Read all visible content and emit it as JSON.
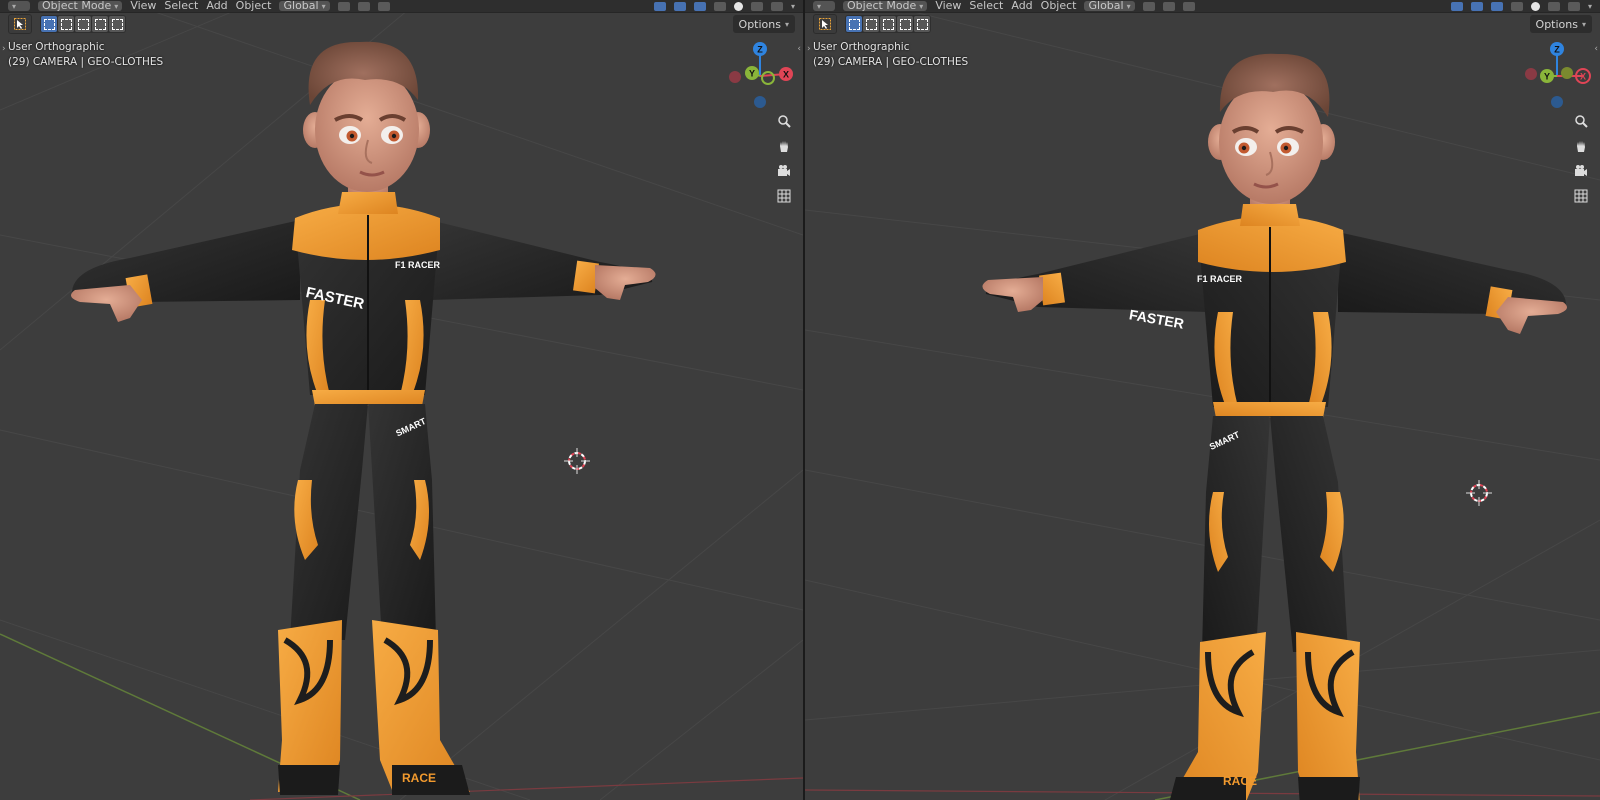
{
  "header": {
    "mode": "Object Mode",
    "menus": [
      "View",
      "Select",
      "Add",
      "Object"
    ],
    "orientation": "Global"
  },
  "toolbar": {
    "options_label": "Options"
  },
  "viewports": [
    {
      "view_name": "User Orthographic",
      "collection_info": "(29) CAMERA | GEO-CLOTHES"
    },
    {
      "view_name": "User Orthographic",
      "collection_info": "(29) CAMERA | GEO-CLOTHES"
    }
  ],
  "gizmo": {
    "x_label": "X",
    "y_label": "Y",
    "z_label": "Z"
  },
  "figure": {
    "chest_logo": "F1 RACER",
    "chest_text": "FASTER",
    "hip_text": "SMART",
    "boot_text": "RACE"
  },
  "colors": {
    "viewport_bg": "#3d3d3d",
    "header_bg": "#2e2e2e",
    "suit_orange": "#f29a2e",
    "suit_black": "#232323",
    "accent_blue": "#4772b3",
    "axis_x": "#e04556",
    "axis_y": "#8ab53a",
    "axis_z": "#2f84e0"
  }
}
